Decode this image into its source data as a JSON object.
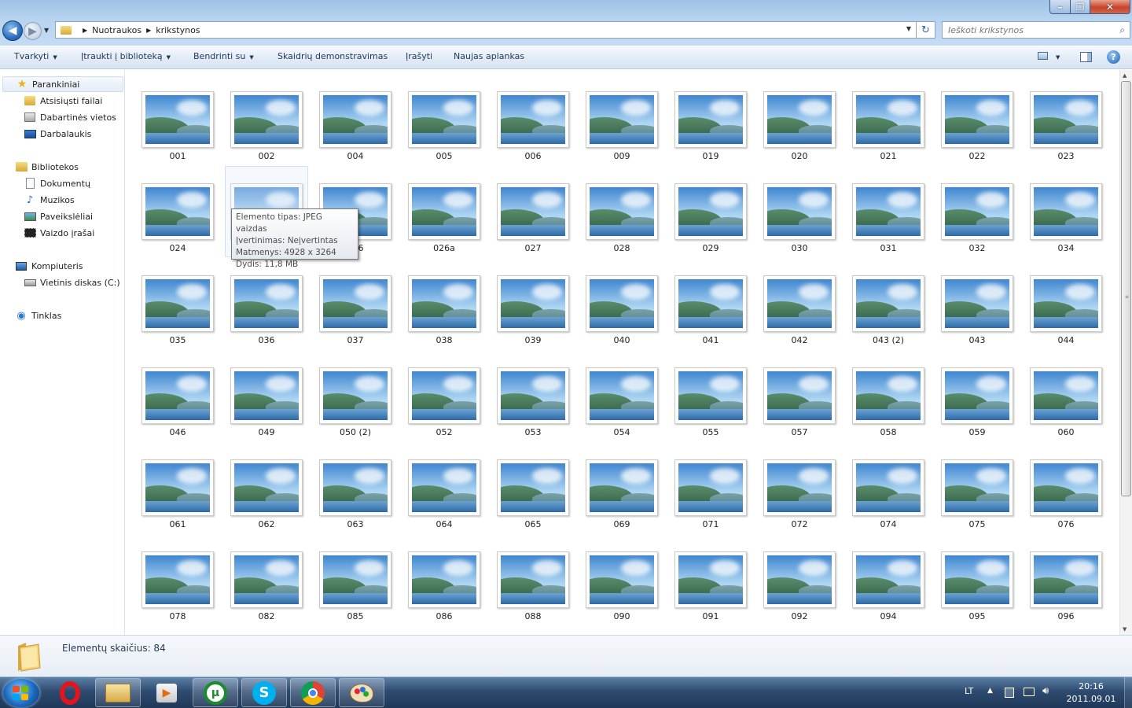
{
  "window": {
    "controls": {
      "minimize": "–",
      "maximize": "❐",
      "close": "✕"
    }
  },
  "address": {
    "crumbs": [
      "Nuotraukos",
      "krikstynos"
    ]
  },
  "search": {
    "placeholder": "Ieškoti krikstynos"
  },
  "toolbar": {
    "organize": "Tvarkyti",
    "include_library": "Įtraukti į biblioteką",
    "share": "Bendrinti su",
    "slideshow": "Skaidrių demonstravimas",
    "burn": "Įrašyti",
    "new_folder": "Naujas aplankas",
    "help": "?"
  },
  "sidebar": {
    "favorites": "Parankiniai",
    "downloads": "Atsisiųsti failai",
    "recent": "Dabartinės vietos",
    "desktop": "Darbalaukis",
    "libraries": "Bibliotekos",
    "documents": "Dokumentų",
    "music": "Muzikos",
    "pictures": "Paveikslėliai",
    "videos": "Vaizdo įrašai",
    "computer": "Kompiuteris",
    "local_disk": "Vietinis diskas (C:)",
    "network": "Tinklas"
  },
  "files": [
    "001",
    "002",
    "004",
    "005",
    "006",
    "009",
    "019",
    "020",
    "021",
    "022",
    "023",
    "024",
    "025",
    "026",
    "026a",
    "027",
    "028",
    "029",
    "030",
    "031",
    "032",
    "034",
    "035",
    "036",
    "037",
    "038",
    "039",
    "040",
    "041",
    "042",
    "043 (2)",
    "043",
    "044",
    "046",
    "049",
    "050 (2)",
    "052",
    "053",
    "054",
    "055",
    "057",
    "058",
    "059",
    "060",
    "061",
    "062",
    "063",
    "064",
    "065",
    "069",
    "071",
    "072",
    "074",
    "075",
    "076",
    "078",
    "082",
    "085",
    "086",
    "088",
    "090",
    "091",
    "092",
    "094",
    "095",
    "096"
  ],
  "tooltip": {
    "type": "Elemento tipas: JPEG vaizdas",
    "rating": "Įvertinimas: Neįvertintas",
    "dimensions": "Matmenys: 4928 x 3264",
    "size": "Dydis: 11,8 MB"
  },
  "details": {
    "count": "Elementų skaičius: 84"
  },
  "taskbar": {
    "language": "LT",
    "time": "20:16",
    "date": "2011.09.01"
  },
  "colors": {
    "accent": "#1e395b",
    "selection": "#cfe2f6"
  }
}
